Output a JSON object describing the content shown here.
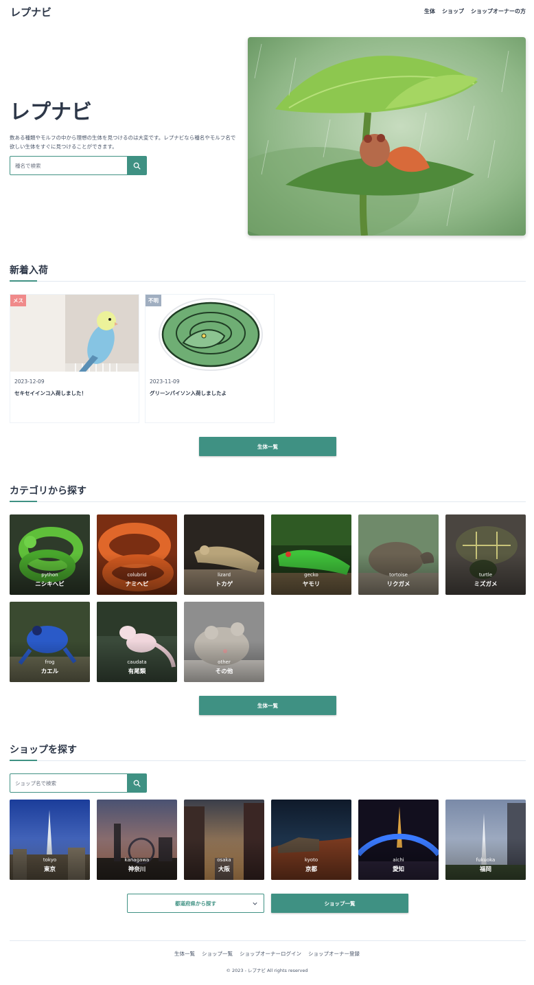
{
  "header": {
    "logo": "レプナビ",
    "nav": [
      "生体",
      "ショップ",
      "ショップオーナーの方"
    ]
  },
  "hero": {
    "title": "レプナビ",
    "description": "数ある種類やモルフの中から理想の生体を見つけるのは大変です。レプナビなら種名やモルフ名で欲しい生体をすぐに見つけることができます。",
    "search_placeholder": "種名で検索",
    "image_icon": "frog-on-leaf-photo"
  },
  "news": {
    "title": "新着入荷",
    "cards": [
      {
        "badge": "メス",
        "badge_color": "#f08a8a",
        "date": "2023-12-09",
        "title": "セキセイインコ入荷しました！"
      },
      {
        "badge": "不明",
        "badge_color": "#a0aec0",
        "date": "2023-11-09",
        "title": "グリーンパイソン入荷しましたよ"
      }
    ],
    "button": "生体一覧"
  },
  "categories": {
    "title": "カテゴリから探す",
    "items": [
      {
        "en": "python",
        "ja": "ニシキヘビ"
      },
      {
        "en": "colubrid",
        "ja": "ナミヘビ"
      },
      {
        "en": "lizard",
        "ja": "トカゲ"
      },
      {
        "en": "gecko",
        "ja": "ヤモリ"
      },
      {
        "en": "tortoise",
        "ja": "リクガメ"
      },
      {
        "en": "turtle",
        "ja": "ミズガメ"
      },
      {
        "en": "frog",
        "ja": "カエル"
      },
      {
        "en": "caudata",
        "ja": "有尾類"
      },
      {
        "en": "other",
        "ja": "その他"
      }
    ],
    "button": "生体一覧"
  },
  "shops": {
    "title": "ショップを探す",
    "search_placeholder": "ショップ名で検索",
    "areas": [
      {
        "en": "tokyo",
        "ja": "東京"
      },
      {
        "en": "kanagawa",
        "ja": "神奈川"
      },
      {
        "en": "osaka",
        "ja": "大阪"
      },
      {
        "en": "kyoto",
        "ja": "京都"
      },
      {
        "en": "aichi",
        "ja": "愛知"
      },
      {
        "en": "fukuoka",
        "ja": "福岡"
      }
    ],
    "pref_select": "都道府県から探す",
    "button": "ショップ一覧"
  },
  "footer": {
    "links": [
      "生体一覧",
      "ショップ一覧",
      "ショップオーナーログイン",
      "ショップオーナー登録"
    ],
    "copyright": "© 2023 - レプナビ All rights reserved"
  },
  "colors": {
    "accent": "#3f9183",
    "text": "#2d3748"
  }
}
